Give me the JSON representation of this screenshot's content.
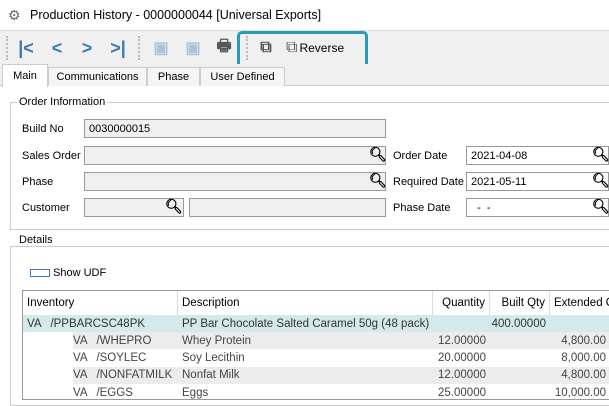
{
  "window": {
    "title": "Production History - 0000000044 [Universal Exports]"
  },
  "toolbar": {
    "reverse_label": "Reverse"
  },
  "tabs": [
    "Main",
    "Communications",
    "Phase",
    "User Defined"
  ],
  "order_info": {
    "group_label": "Order Information",
    "build_no_label": "Build No",
    "build_no": "0030000015",
    "sales_order_label": "Sales Order",
    "sales_order": "",
    "phase_label": "Phase",
    "phase": "",
    "customer_label": "Customer",
    "customer": "",
    "customer_name": "",
    "order_date_label": "Order Date",
    "order_date": "2021-04-08",
    "required_date_label": "Required Date",
    "required_date": "2021-05-11",
    "phase_date_label": "Phase Date",
    "phase_date": "  -  -"
  },
  "details": {
    "group_label": "Details",
    "show_udf_label": "Show UDF",
    "columns": [
      "Inventory",
      "Description",
      "Quantity",
      "Built Qty",
      "Extended Cost"
    ],
    "rows": [
      {
        "inventory": "VA   /PPBARCSC48PK",
        "description": "PP Bar Chocolate Salted Caramel 50g (48 pack)",
        "quantity": "",
        "built": "400.00000",
        "extended": ""
      },
      {
        "inventory": "VA   /WHEPRO",
        "description": "Whey Protein",
        "quantity": "12.00000",
        "built": "",
        "extended": "4,800.00"
      },
      {
        "inventory": "VA   /SOYLEC",
        "description": "Soy Lecithin",
        "quantity": "20.00000",
        "built": "",
        "extended": "8,000.00"
      },
      {
        "inventory": "VA   /NONFATMILK",
        "description": "Nonfat Milk",
        "quantity": "12.00000",
        "built": "",
        "extended": "4,800.00"
      },
      {
        "inventory": "VA   /EGGS",
        "description": "Eggs",
        "quantity": "25.00000",
        "built": "",
        "extended": "10,000.00"
      }
    ]
  }
}
